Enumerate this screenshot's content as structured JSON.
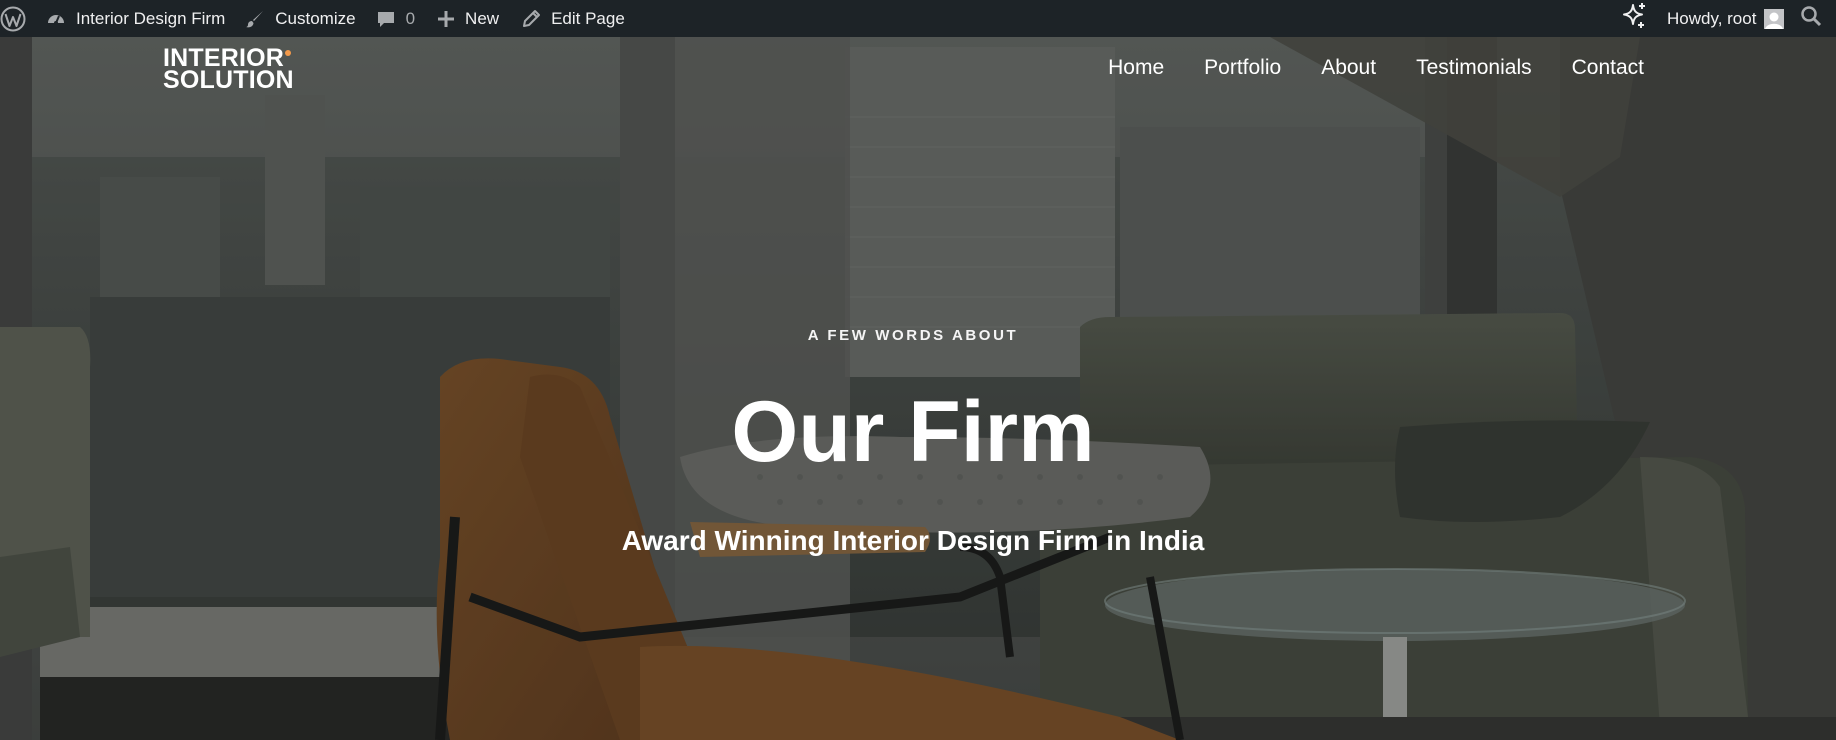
{
  "admin_bar": {
    "site_name": "Interior Design Firm",
    "customize": "Customize",
    "comments_count": "0",
    "new": "New",
    "edit_page": "Edit Page",
    "howdy": "Howdy, root"
  },
  "header": {
    "logo_line1": "INTERIOR",
    "logo_line2": "SOLUTION",
    "nav": [
      "Home",
      "Portfolio",
      "About",
      "Testimonials",
      "Contact"
    ]
  },
  "hero": {
    "kicker": "A FEW WORDS ABOUT",
    "title": "Our Firm",
    "tagline": "Award Winning Interior Design Firm in India"
  },
  "colors": {
    "admin_bar_bg": "#1d2327",
    "logo_accent": "#f2994a",
    "text": "#ffffff"
  }
}
